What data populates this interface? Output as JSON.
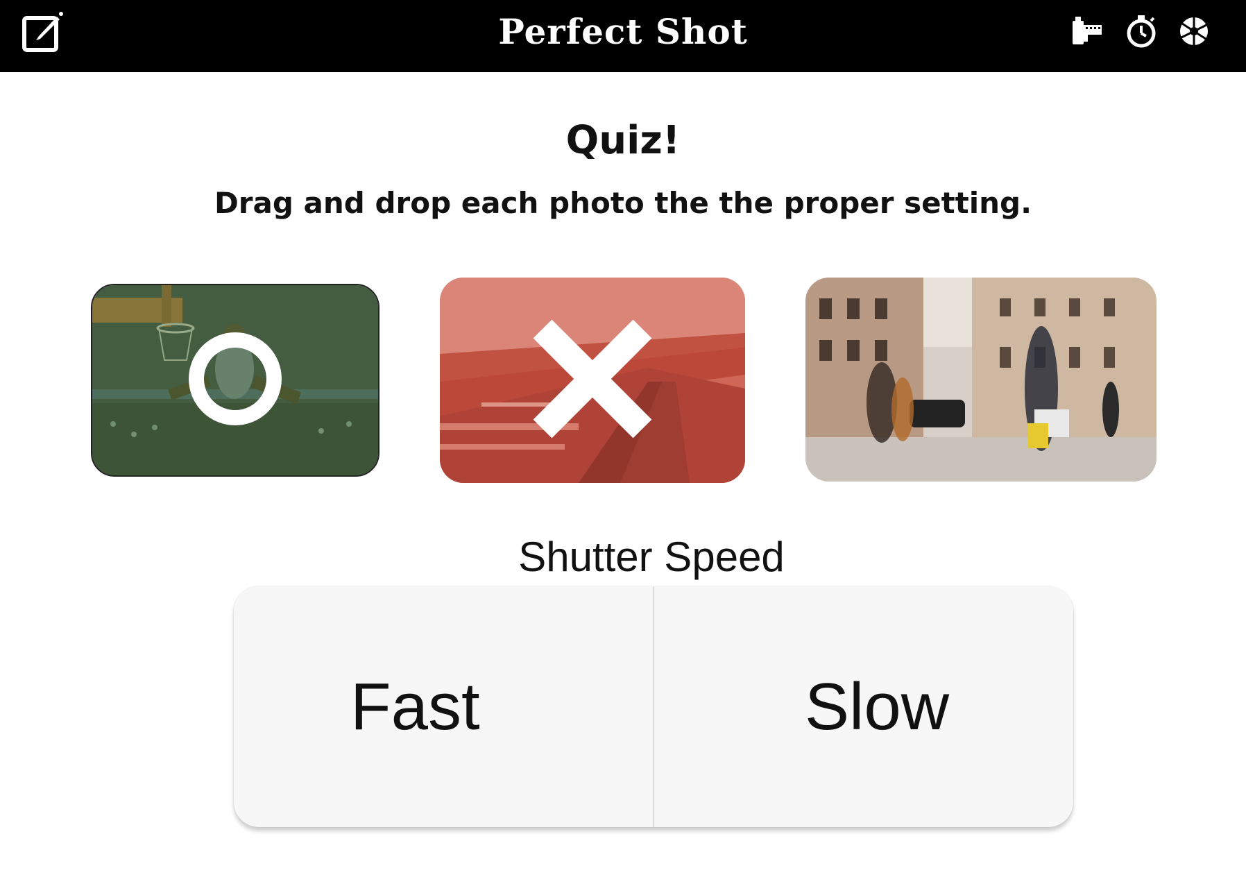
{
  "header": {
    "title": "Perfect Shot",
    "icons": [
      "edit-icon",
      "film-roll-icon",
      "stopwatch-icon",
      "aperture-icon"
    ],
    "background": "#000000",
    "text_color": "#ffffff"
  },
  "quiz": {
    "title": "Quiz!",
    "instructions": "Drag and drop each photo the the proper setting."
  },
  "photos": [
    {
      "subject": "basketball dunk",
      "status": "correct",
      "overlay_icon": "circle-mark-icon",
      "tint": "#5a7a3a"
    },
    {
      "subject": "motion-blurred railway",
      "status": "incorrect",
      "overlay_icon": "x-mark-icon",
      "tint": "#c0453a"
    },
    {
      "subject": "blurred pedestrians on city street",
      "status": "unanswered"
    }
  ],
  "setting": {
    "label": "Shutter Speed",
    "options": [
      "Fast",
      "Slow"
    ]
  }
}
